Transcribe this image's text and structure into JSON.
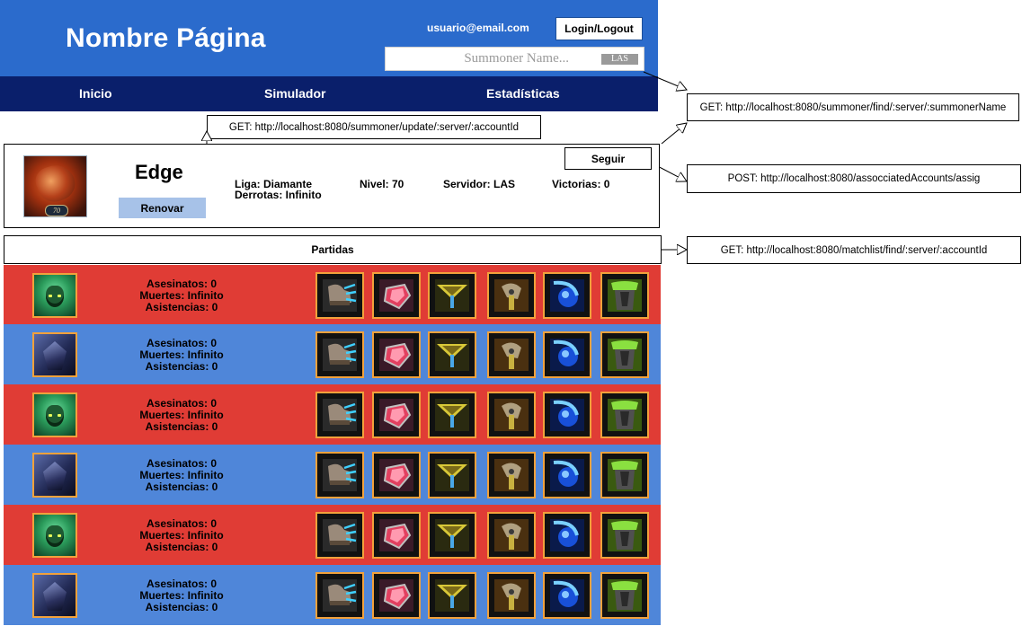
{
  "header": {
    "site_title": "Nombre Página",
    "user_email": "usuario@email.com",
    "login_label": "Login/Logout",
    "search_placeholder": "Summoner Name...",
    "region": "LAS"
  },
  "nav": {
    "items": [
      {
        "label": "Inicio"
      },
      {
        "label": "Simulador"
      },
      {
        "label": "Estadísticas"
      }
    ]
  },
  "annotations": {
    "find_summoner": "GET: http://localhost:8080/summoner/find/:server/:summonerName",
    "update_summoner": "GET: http://localhost:8080/summoner/update/:server/:accountId",
    "assign_account": "POST: http://localhost:8080/assocciatedAccounts/assig",
    "matchlist": "GET: http://localhost:8080/matchlist/find/:server/:accountId"
  },
  "profile": {
    "name": "Edge",
    "level": "70",
    "renew_label": "Renovar",
    "follow_label": "Seguir",
    "league": "Liga: Diamante",
    "defeats": "Derrotas: Infinito",
    "level_text": "Nivel: 70",
    "server": "Servidor: LAS",
    "victories": "Victorias: 0"
  },
  "matches": {
    "header": "Partidas",
    "rows": [
      {
        "result": "loss",
        "champion": "green",
        "kills": "Asesinatos: 0",
        "deaths": "Muertes: Infinito",
        "assists": "Asistencias: 0"
      },
      {
        "result": "win",
        "champion": "dark",
        "kills": "Asesinatos: 0",
        "deaths": "Muertes: Infinito",
        "assists": "Asistencias: 0"
      },
      {
        "result": "loss",
        "champion": "green",
        "kills": "Asesinatos: 0",
        "deaths": "Muertes: Infinito",
        "assists": "Asistencias: 0"
      },
      {
        "result": "win",
        "champion": "dark",
        "kills": "Asesinatos: 0",
        "deaths": "Muertes: Infinito",
        "assists": "Asistencias: 0"
      },
      {
        "result": "loss",
        "champion": "green",
        "kills": "Asesinatos: 0",
        "deaths": "Muertes: Infinito",
        "assists": "Asistencias: 0"
      },
      {
        "result": "win",
        "champion": "dark",
        "kills": "Asesinatos: 0",
        "deaths": "Muertes: Infinito",
        "assists": "Asistencias: 0"
      }
    ],
    "items": [
      "boots-icon",
      "ruby-gem-icon",
      "winged-amulet-icon",
      "cleaver-icon",
      "blue-orb-icon",
      "armor-icon"
    ]
  },
  "colors": {
    "header_bg": "#2b6bcc",
    "nav_bg": "#0a1f6b",
    "loss_row": "#e03c35",
    "win_row": "#4f86d9",
    "item_border": "#f2a13b",
    "renew_btn": "#a7c2e8"
  }
}
